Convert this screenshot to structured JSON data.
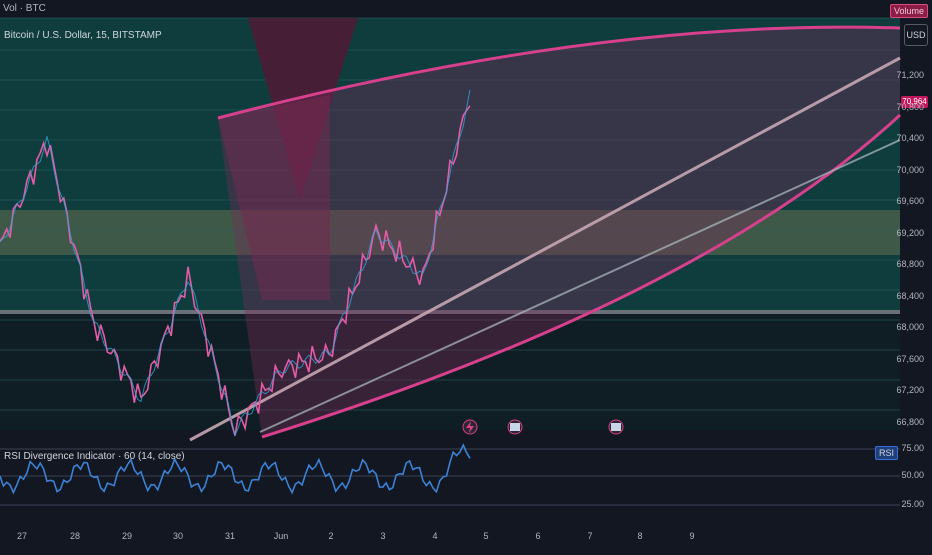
{
  "header": {
    "top_label": "Vol · BTC",
    "symbol_title": "Bitcoin / U.S. Dollar, 15, BITSTAMP",
    "currency": "USD",
    "volume_label": "Volume",
    "last_price_tag": "70,964"
  },
  "rsi": {
    "title": "RSI Divergence Indicator · 60 (14, close)",
    "badge": "RSI",
    "levels": [
      "75.00",
      "50.00",
      "25.00"
    ]
  },
  "price_axis": {
    "labels": [
      "71,200",
      "70,800",
      "70,400",
      "70,000",
      "69,600",
      "69,200",
      "68,800",
      "68,400",
      "68,000",
      "67,600",
      "67,200",
      "66,800"
    ]
  },
  "time_axis": {
    "labels": [
      "27",
      "28",
      "29",
      "30",
      "31",
      "Jun",
      "2",
      "3",
      "4",
      "5",
      "6",
      "7",
      "8",
      "9"
    ]
  },
  "colors": {
    "background": "#131722",
    "teal_zone": "#0f3d3e",
    "pink_band": "#7a2b5a",
    "candle_up": "#2fa6d8",
    "candle_down": "#e45ca5",
    "rsi_line": "#3b82d6"
  },
  "chart_data": {
    "type": "line",
    "title": "Bitcoin / U.S. Dollar, 15, BITSTAMP",
    "xlabel": "",
    "ylabel": "",
    "x_labels": [
      "27",
      "28",
      "29",
      "30",
      "31",
      "Jun",
      "2",
      "3",
      "4",
      "5"
    ],
    "series": [
      {
        "name": "",
        "values": [
          69200,
          70600,
          68200,
          67200,
          68800,
          66800,
          67600,
          67800,
          69400,
          68800,
          71200
        ]
      }
    ],
    "ylim": [
      66800,
      71200
    ],
    "grid": true,
    "legend": "none"
  }
}
